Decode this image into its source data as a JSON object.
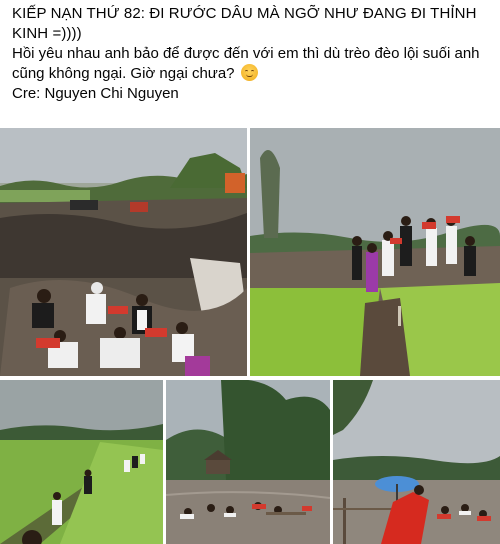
{
  "post": {
    "title_line": "KIẾP NẠN THỨ 82: ĐI RƯỚC DÂU MÀ NGỠ NHƯ ĐANG ĐI THỈNH KINH =))))",
    "body_line": "Hồi yêu nhau anh bảo để được đến với em thì dù trèo đèo lội suối anh cũng không ngại. Giờ ngại chưa?",
    "emoji": "relieved-face",
    "credit_line": "Cre: Nguyen Chi Nguyen"
  },
  "photos": [
    {
      "description_name": "photo-mud-path-procession"
    },
    {
      "description_name": "photo-rice-field-dike"
    },
    {
      "description_name": "photo-field-path-walkers"
    },
    {
      "description_name": "photo-flooded-pond"
    },
    {
      "description_name": "photo-bride-umbrella"
    }
  ],
  "colors": {
    "text": "#050505",
    "background": "#ffffff"
  }
}
